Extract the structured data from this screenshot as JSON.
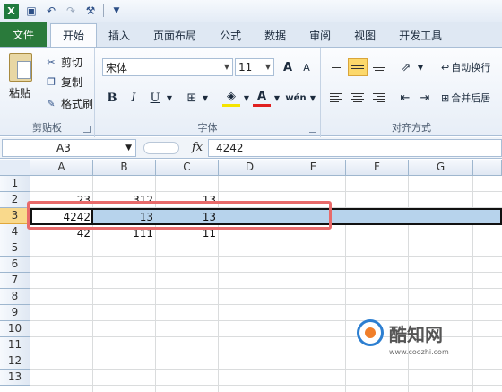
{
  "qat": {
    "logo": "X",
    "undo_icon": "undo-icon",
    "redo_icon": "redo-icon"
  },
  "tabs": [
    {
      "label": "文件"
    },
    {
      "label": "开始"
    },
    {
      "label": "插入"
    },
    {
      "label": "页面布局"
    },
    {
      "label": "公式"
    },
    {
      "label": "数据"
    },
    {
      "label": "审阅"
    },
    {
      "label": "视图"
    },
    {
      "label": "开发工具"
    }
  ],
  "ribbon": {
    "clipboard": {
      "paste": "粘贴",
      "cut": "剪切",
      "copy": "复制",
      "format_painter": "格式刷",
      "label": "剪贴板"
    },
    "font": {
      "name": "宋体",
      "size": "11",
      "bold": "B",
      "italic": "I",
      "underline": "U",
      "label": "字体",
      "grow": "A",
      "shrink": "A",
      "wen": "wén"
    },
    "alignment": {
      "wrap": "自动换行",
      "merge": "合并后居",
      "label": "对齐方式"
    }
  },
  "formula_bar": {
    "name_box": "A3",
    "fx": "fx",
    "value": "4242"
  },
  "columns": [
    "A",
    "B",
    "C",
    "D",
    "E",
    "F",
    "G"
  ],
  "rows": [
    "1",
    "2",
    "3",
    "4",
    "5",
    "6",
    "7",
    "8",
    "9",
    "10",
    "11",
    "12",
    "13"
  ],
  "cells": {
    "A2": "23",
    "B2": "312",
    "C2": "13",
    "A3": "4242",
    "B3": "13",
    "C3": "13",
    "A4": "42",
    "B4": "111",
    "C4": "11"
  },
  "watermark": {
    "name": "酷知网",
    "url": "www.coozhi.com"
  },
  "colors": {
    "file_tab": "#2a7a3b",
    "selection": "#b7d3ec",
    "highlight_box": "#e86a6a"
  }
}
